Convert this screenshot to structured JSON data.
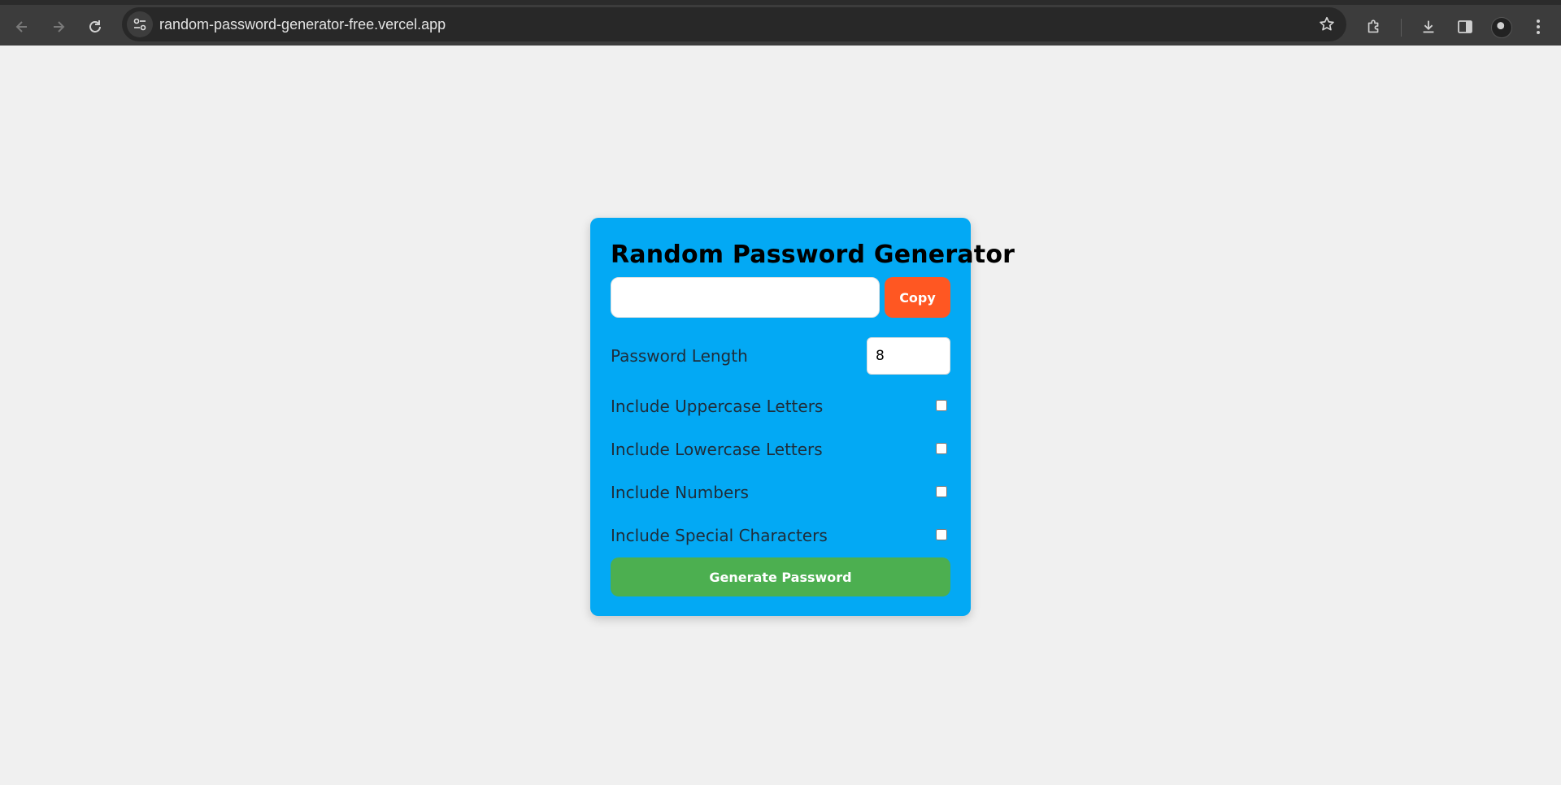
{
  "browser": {
    "url": "random-password-generator-free.vercel.app",
    "icons": {
      "back": "arrow-left-icon",
      "forward": "arrow-right-icon",
      "reload": "reload-icon",
      "site_info": "tune-icon",
      "bookmark": "star-icon",
      "extensions": "puzzle-icon",
      "downloads": "download-icon",
      "side_panel": "side-panel-icon",
      "menu": "kebab-menu-icon"
    }
  },
  "app": {
    "title": "Random Password Generator",
    "password_value": "",
    "copy_label": "Copy",
    "length_label": "Password Length",
    "length_value": "8",
    "options": [
      {
        "label": "Include Uppercase Letters",
        "checked": false
      },
      {
        "label": "Include Lowercase Letters",
        "checked": false
      },
      {
        "label": "Include Numbers",
        "checked": false
      },
      {
        "label": "Include Special Characters",
        "checked": false
      }
    ],
    "generate_label": "Generate Password"
  },
  "colors": {
    "page_background": "#f0f0f0",
    "card": "#03a9f4",
    "copy_button": "#ff5722",
    "generate_button": "#4caf50",
    "browser_toolbar": "#3c3c3c"
  }
}
